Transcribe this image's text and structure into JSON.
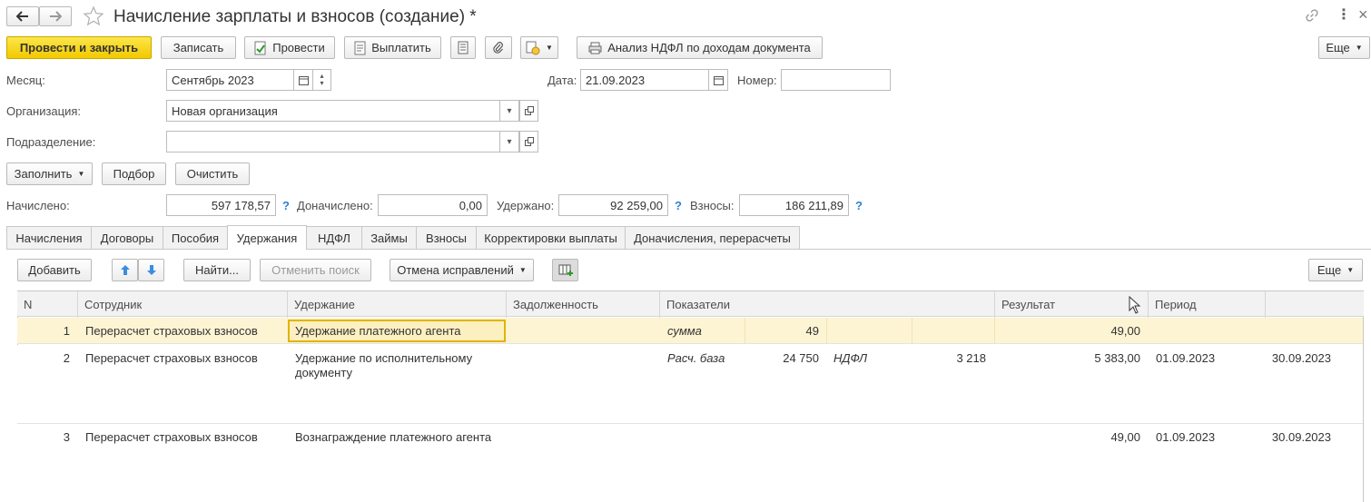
{
  "window": {
    "title": "Начисление зарплаты и взносов (создание) *"
  },
  "toolbar": {
    "post_close": "Провести и закрыть",
    "save": "Записать",
    "post": "Провести",
    "pay": "Выплатить",
    "ndfl_analysis": "Анализ НДФЛ по доходам документа",
    "more": "Еще"
  },
  "header": {
    "month_label": "Месяц:",
    "month_value": "Сентябрь 2023",
    "date_label": "Дата:",
    "date_value": "21.09.2023",
    "number_label": "Номер:",
    "number_value": "",
    "org_label": "Организация:",
    "org_value": "Новая организация",
    "dept_label": "Подразделение:",
    "dept_value": ""
  },
  "actions": {
    "fill": "Заполнить",
    "select": "Подбор",
    "clear": "Очистить"
  },
  "totals": {
    "accrued_label": "Начислено:",
    "accrued_value": "597 178,57",
    "additional_label": "Доначислено:",
    "additional_value": "0,00",
    "withheld_label": "Удержано:",
    "withheld_value": "92 259,00",
    "contributions_label": "Взносы:",
    "contributions_value": "186 211,89",
    "help": "?"
  },
  "tabs": [
    {
      "label": "Начисления"
    },
    {
      "label": "Договоры"
    },
    {
      "label": "Пособия"
    },
    {
      "label": "Удержания"
    },
    {
      "label": "НДФЛ"
    },
    {
      "label": "Займы"
    },
    {
      "label": "Взносы"
    },
    {
      "label": "Корректировки выплаты"
    },
    {
      "label": "Доначисления, перерасчеты"
    }
  ],
  "table_toolbar": {
    "add": "Добавить",
    "find": "Найти...",
    "cancel_search": "Отменить поиск",
    "cancel_corrections": "Отмена исправлений",
    "more": "Еще"
  },
  "table": {
    "columns": [
      "N",
      "Сотрудник",
      "Удержание",
      "Задолженность",
      "Показатели",
      "Результат",
      "Период"
    ],
    "rows": [
      {
        "n": "1",
        "employee": "Перерасчет страховых взносов",
        "deduction": "Удержание платежного агента",
        "debt": "",
        "ind1_name": "сумма",
        "ind1_value": "49",
        "ind2_name": "",
        "ind2_value": "",
        "result": "49,00",
        "period_start": "",
        "period_end": ""
      },
      {
        "n": "2",
        "employee": "Перерасчет страховых взносов",
        "deduction": "Удержание по исполнительному документу",
        "debt": "",
        "ind1_name": "Расч. база",
        "ind1_value": "24 750",
        "ind2_name": "НДФЛ",
        "ind2_value": "3 218",
        "result": "5 383,00",
        "period_start": "01.09.2023",
        "period_end": "30.09.2023"
      },
      {
        "n": "3",
        "employee": "Перерасчет страховых взносов",
        "deduction": "Вознаграждение платежного агента",
        "debt": "",
        "ind1_name": "",
        "ind1_value": "",
        "ind2_name": "",
        "ind2_value": "",
        "result": "49,00",
        "period_start": "01.09.2023",
        "period_end": "30.09.2023"
      }
    ]
  },
  "colors": {
    "primary_button": "#f2c900",
    "selected_row": "#fdf4d3",
    "selected_cell_border": "#e0b400",
    "help_icon": "#2d7fd3"
  }
}
